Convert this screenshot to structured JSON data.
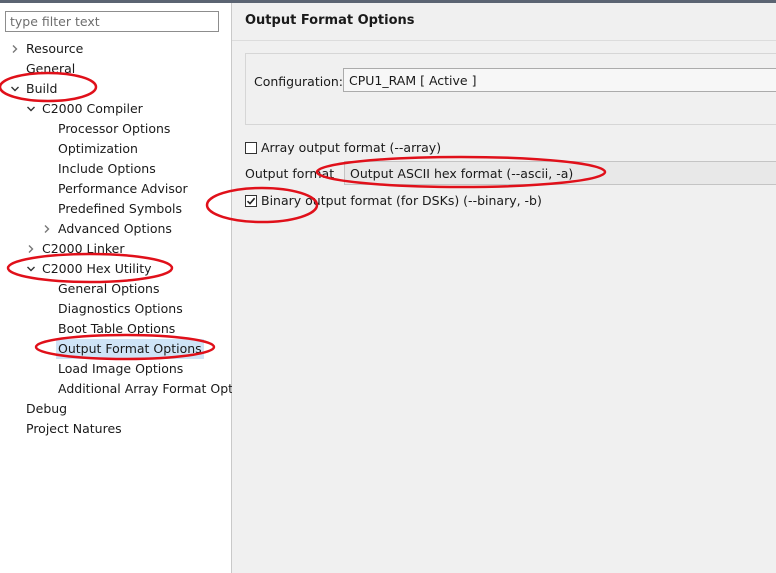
{
  "filter": {
    "placeholder": "type filter text"
  },
  "tree": [
    {
      "label": "Resource",
      "expander": "collapsed"
    },
    {
      "label": "General",
      "expander": "none"
    },
    {
      "label": "Build",
      "expander": "expanded"
    },
    {
      "label": "C2000 Compiler",
      "expander": "expanded"
    },
    {
      "label": "Processor Options",
      "expander": "none"
    },
    {
      "label": "Optimization",
      "expander": "none"
    },
    {
      "label": "Include Options",
      "expander": "none"
    },
    {
      "label": "Performance Advisor",
      "expander": "none"
    },
    {
      "label": "Predefined Symbols",
      "expander": "none"
    },
    {
      "label": "Advanced Options",
      "expander": "collapsed"
    },
    {
      "label": "C2000 Linker",
      "expander": "collapsed"
    },
    {
      "label": "C2000 Hex Utility",
      "expander": "expanded"
    },
    {
      "label": "General Options",
      "expander": "none"
    },
    {
      "label": "Diagnostics Options",
      "expander": "none"
    },
    {
      "label": "Boot Table Options",
      "expander": "none"
    },
    {
      "label": "Output Format Options",
      "expander": "none",
      "selected": true
    },
    {
      "label": "Load Image Options",
      "expander": "none"
    },
    {
      "label": "Additional Array Format Opt",
      "expander": "none"
    },
    {
      "label": "Debug",
      "expander": "none"
    },
    {
      "label": "Project Natures",
      "expander": "none"
    }
  ],
  "main": {
    "title": "Output Format Options",
    "configuration_label": "Configuration:",
    "configuration_value": "CPU1_RAM  [ Active ]",
    "array_output": {
      "label": "Array output format (--array)",
      "checked": false
    },
    "output_format_label": "Output format",
    "output_format_value": "Output ASCII hex format (--ascii, -a)",
    "binary_output": {
      "label": "Binary output format (for DSKs) (--binary, -b)",
      "checked": true
    }
  },
  "colors": {
    "annotation": "#e0101a",
    "selection": "#cfe4f7",
    "panel_bg": "#f0f0f0"
  }
}
